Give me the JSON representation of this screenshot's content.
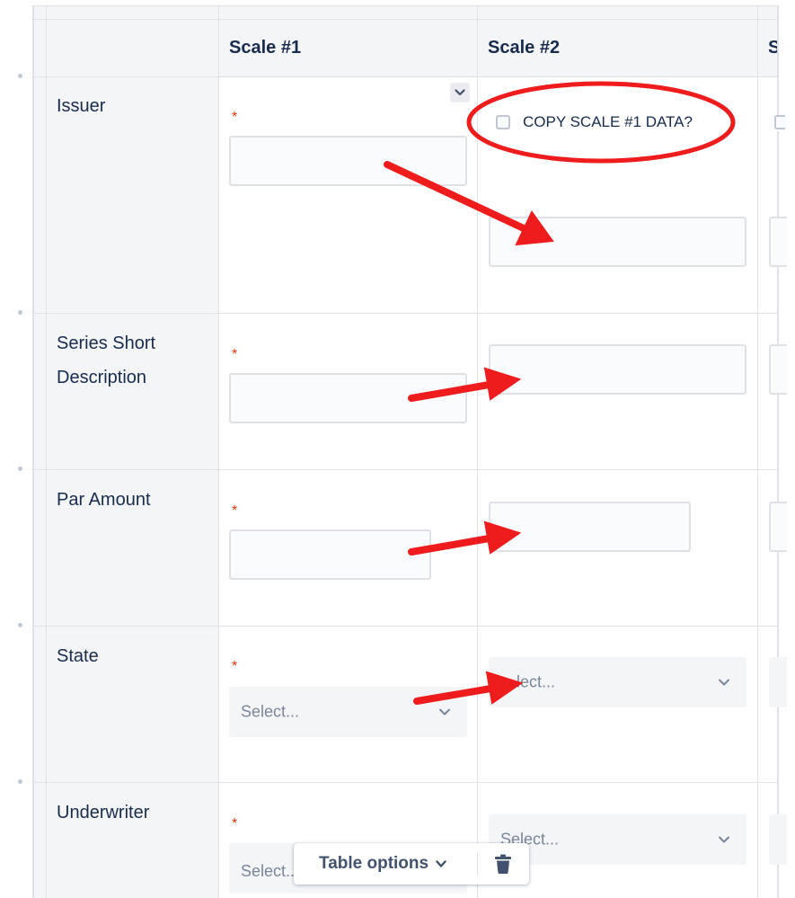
{
  "table": {
    "columns": [
      "Scale #1",
      "Scale #2",
      "S"
    ],
    "rows": [
      {
        "label": "Issuer"
      },
      {
        "label_line1": "Series Short",
        "label_line2": "Description"
      },
      {
        "label": "Par Amount"
      },
      {
        "label": "State"
      },
      {
        "label": "Underwriter"
      }
    ],
    "required_marker": "*",
    "select_placeholder": "Select...",
    "state_scale2_visible_text": "lect...",
    "underwriter_scale2_visible_text": "Select...",
    "underwriter_scale1_visible_text": "Select..."
  },
  "copy_option": {
    "label": "COPY SCALE #1 DATA?",
    "checked": false
  },
  "toolbar": {
    "table_options_label": "Table options"
  },
  "icons": {
    "dropdown": "chevron-down-icon",
    "delete": "trash-icon",
    "checkbox": "checkbox-icon"
  },
  "colors": {
    "annotation": "#ee1c1c",
    "required": "#de350b",
    "header_bg": "#f4f5f7",
    "border": "#dfe1e6"
  }
}
